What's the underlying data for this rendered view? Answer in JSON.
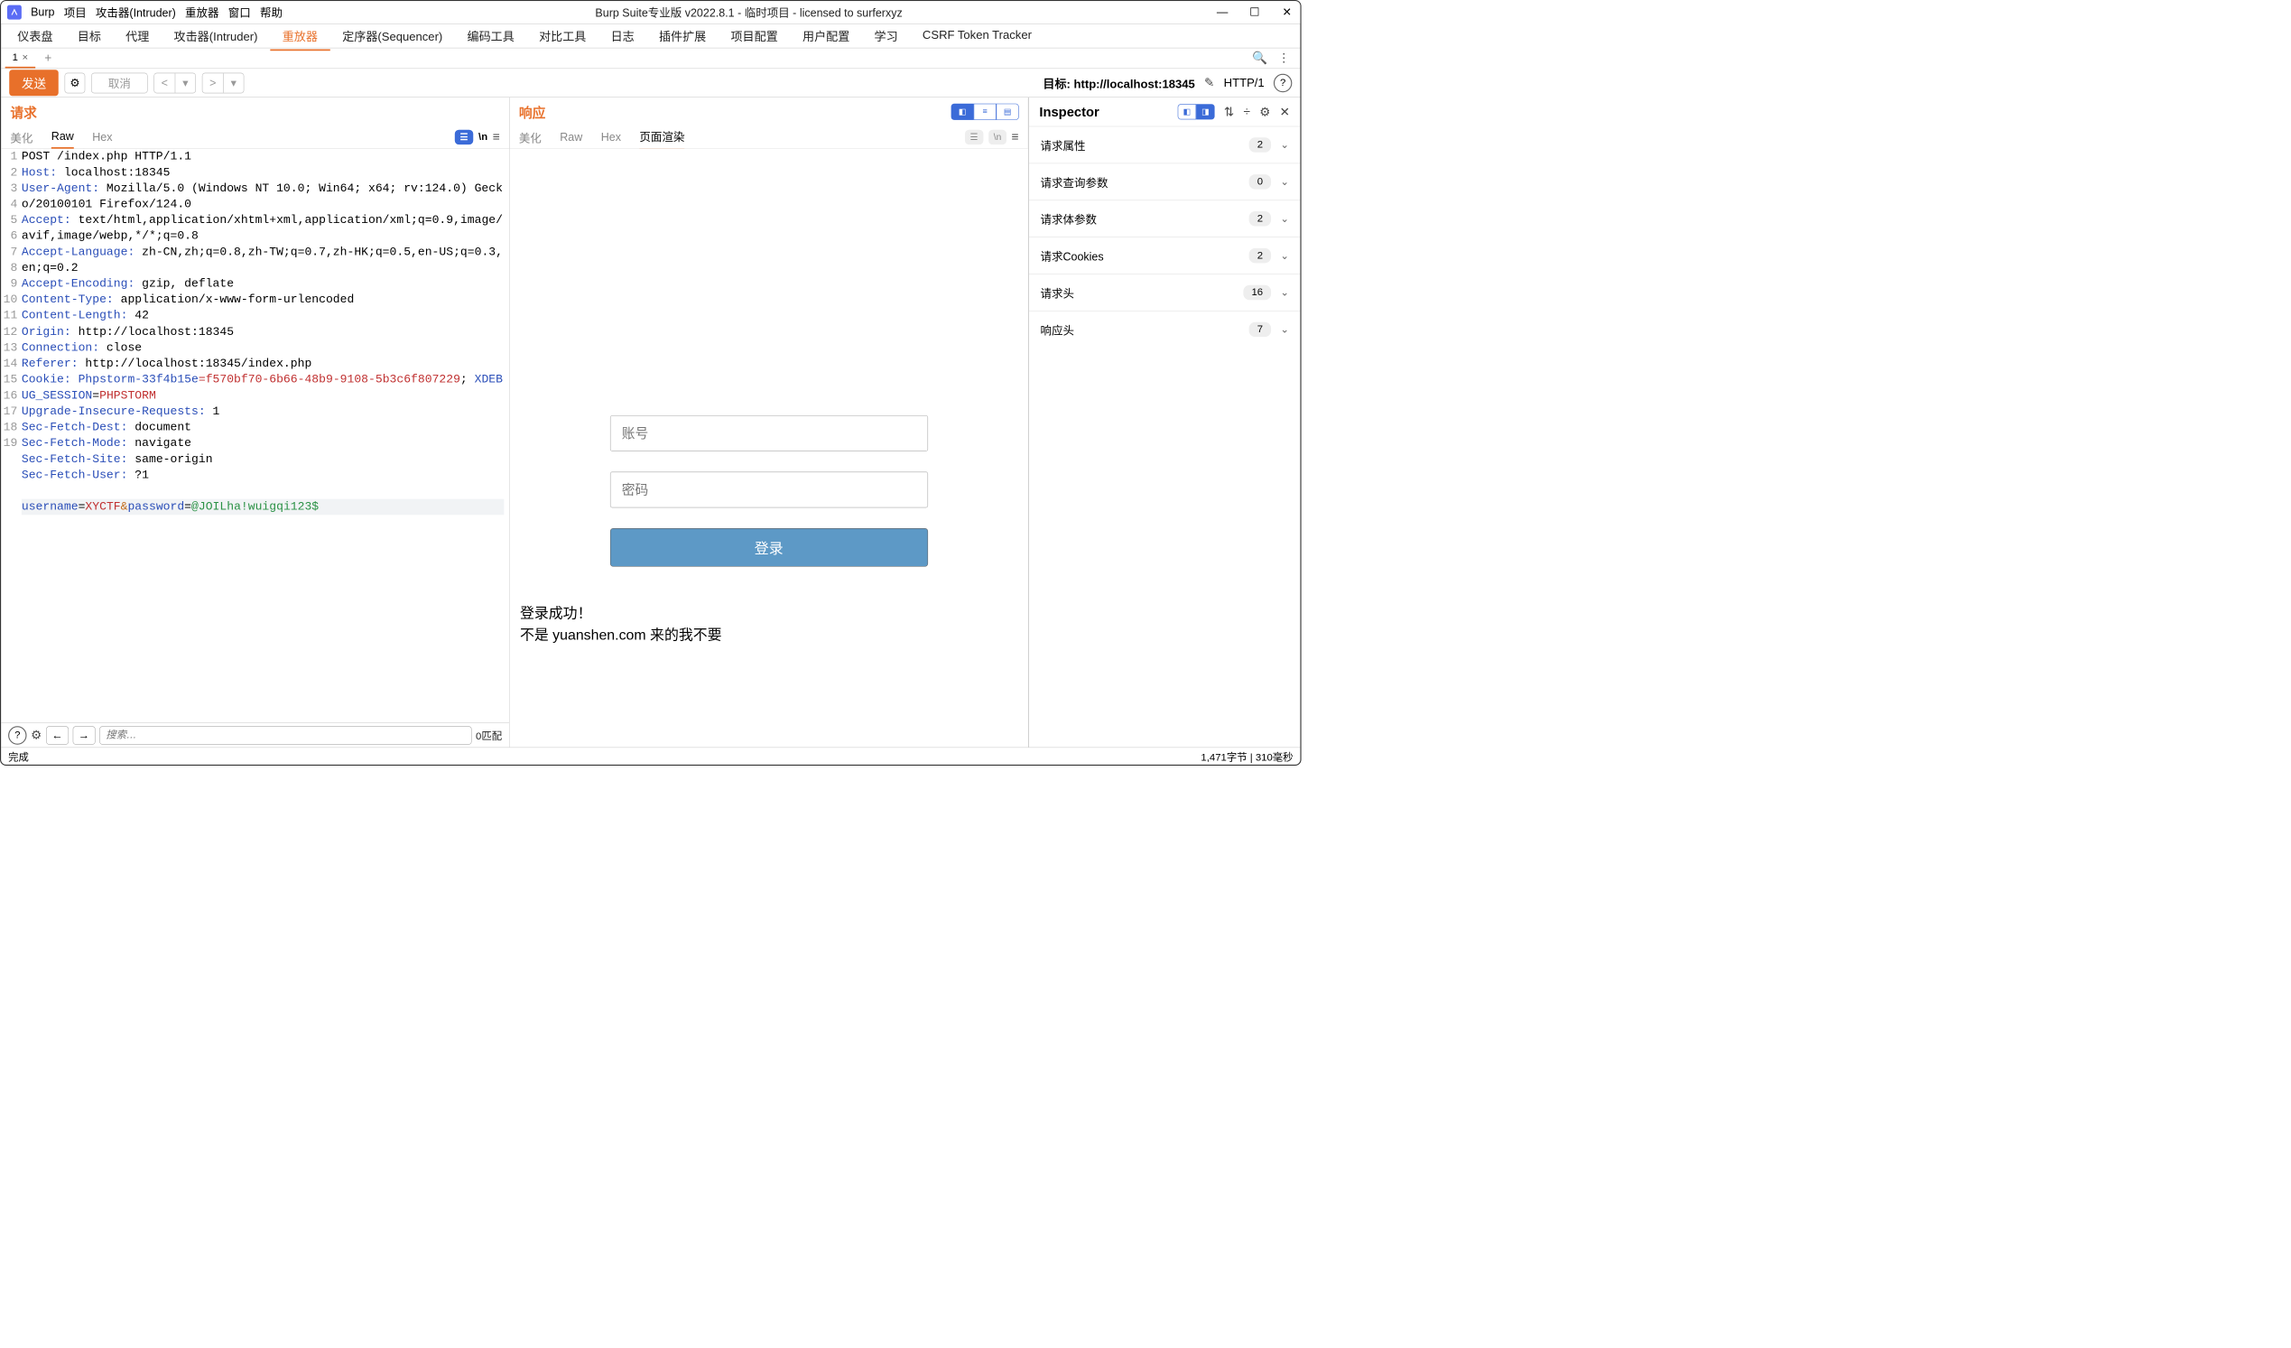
{
  "menubar": {
    "app": "Burp",
    "items": [
      "项目",
      "攻击器(Intruder)",
      "重放器",
      "窗口",
      "帮助"
    ]
  },
  "title": "Burp Suite专业版  v2022.8.1 - 临时项目 - licensed to surferxyz",
  "toptabs": [
    "仪表盘",
    "目标",
    "代理",
    "攻击器(Intruder)",
    "重放器",
    "定序器(Sequencer)",
    "编码工具",
    "对比工具",
    "日志",
    "插件扩展",
    "项目配置",
    "用户配置",
    "学习",
    "CSRF Token Tracker"
  ],
  "toptab_active": 4,
  "subtab": {
    "label": "1"
  },
  "actionbar": {
    "send": "发送",
    "cancel": "取消",
    "target_label": "目标: http://localhost:18345",
    "http": "HTTP/1"
  },
  "request": {
    "title": "请求",
    "tabs": [
      "美化",
      "Raw",
      "Hex"
    ],
    "tab_active": 1,
    "lines": [
      {
        "n": "1",
        "plain": "POST /index.php HTTP/1.1"
      },
      {
        "n": "2",
        "h": "Host:",
        "v": " localhost:18345"
      },
      {
        "n": "3",
        "h": "User-Agent:",
        "v": " Mozilla/5.0 (Windows NT 10.0; Win64; x64; rv:124.0) Gecko/20100101 Firefox/124.0"
      },
      {
        "n": "4",
        "h": "Accept:",
        "v": " text/html,application/xhtml+xml,application/xml;q=0.9,image/avif,image/webp,*/*;q=0.8"
      },
      {
        "n": "5",
        "h": "Accept-Language:",
        "v": " zh-CN,zh;q=0.8,zh-TW;q=0.7,zh-HK;q=0.5,en-US;q=0.3,en;q=0.2"
      },
      {
        "n": "6",
        "h": "Accept-Encoding:",
        "v": " gzip, deflate"
      },
      {
        "n": "7",
        "h": "Content-Type:",
        "v": " application/x-www-form-urlencoded"
      },
      {
        "n": "8",
        "h": "Content-Length:",
        "v": " 42"
      },
      {
        "n": "9",
        "h": "Origin:",
        "v": " http://localhost:18345"
      },
      {
        "n": "10",
        "h": "Connection:",
        "v": " close"
      },
      {
        "n": "11",
        "h": "Referer:",
        "v": " http://localhost:18345/index.php"
      },
      {
        "n": "12",
        "cookie": {
          "h": "Cookie:",
          "k1": " Phpstorm-33f4b15e",
          "v1": "=f570bf70-6b66-48b9-9108-5b3c6f807229",
          "sep": "; ",
          "k2": "XDEBUG_SESSION",
          "eq": "=",
          "v2": "PHPSTORM"
        }
      },
      {
        "n": "13",
        "h": "Upgrade-Insecure-Requests:",
        "v": " 1"
      },
      {
        "n": "14",
        "h": "Sec-Fetch-Dest:",
        "v": " document"
      },
      {
        "n": "15",
        "h": "Sec-Fetch-Mode:",
        "v": " navigate"
      },
      {
        "n": "16",
        "h": "Sec-Fetch-Site:",
        "v": " same-origin"
      },
      {
        "n": "17",
        "h": "Sec-Fetch-User:",
        "v": " ?1"
      },
      {
        "n": "18",
        "plain": ""
      },
      {
        "n": "19",
        "body": {
          "k1": "username",
          "eq1": "=",
          "v1": "XYCTF",
          "amp": "&",
          "k2": "password",
          "eq2": "=",
          "v2": "@JOILha!wuigqi123$"
        }
      }
    ],
    "search_placeholder": "搜索…",
    "match": "0匹配"
  },
  "response": {
    "title": "响应",
    "tabs": [
      "美化",
      "Raw",
      "Hex",
      "页面渲染"
    ],
    "tab_active": 3,
    "render": {
      "user_ph": "账号",
      "pass_ph": "密码",
      "login": "登录",
      "msg1": "登录成功！",
      "msg2": "不是 yuanshen.com 来的我不要"
    }
  },
  "inspector": {
    "title": "Inspector",
    "rows": [
      {
        "label": "请求属性",
        "count": "2"
      },
      {
        "label": "请求查询参数",
        "count": "0"
      },
      {
        "label": "请求体参数",
        "count": "2"
      },
      {
        "label": "请求Cookies",
        "count": "2"
      },
      {
        "label": "请求头",
        "count": "16"
      },
      {
        "label": "响应头",
        "count": "7"
      }
    ]
  },
  "status": {
    "left": "完成",
    "right": "1,471字节 | 310毫秒"
  }
}
